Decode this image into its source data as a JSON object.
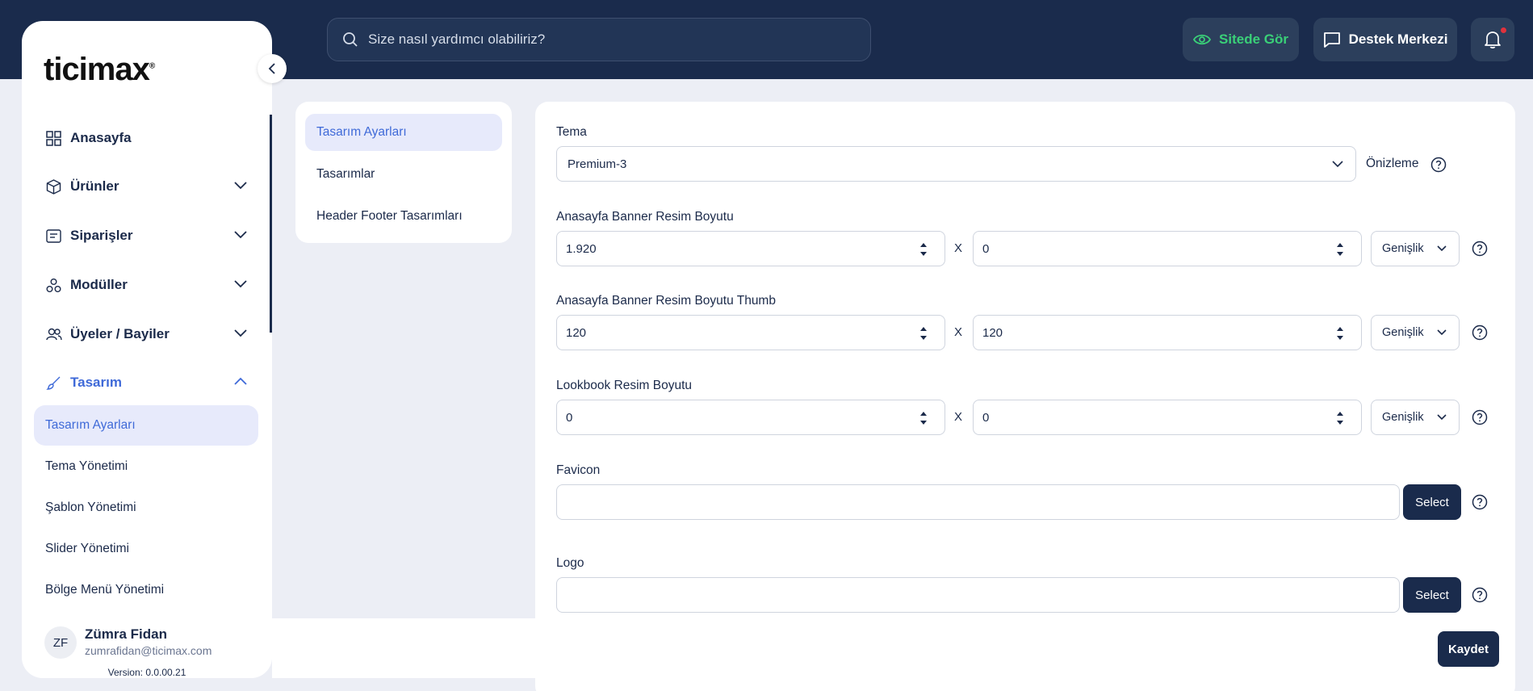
{
  "header": {
    "search_placeholder": "Size nasıl yardımcı olabiliriz?",
    "site_button": "Sitede Gör",
    "support_button": "Destek Merkezi"
  },
  "sidebar": {
    "logo": "ticimax",
    "items": [
      {
        "label": "Anasayfa",
        "icon": "grid-icon"
      },
      {
        "label": "Ürünler",
        "icon": "box-icon"
      },
      {
        "label": "Siparişler",
        "icon": "list-icon"
      },
      {
        "label": "Modüller",
        "icon": "modules-icon"
      },
      {
        "label": "Üyeler / Bayiler",
        "icon": "users-icon"
      },
      {
        "label": "Tasarım",
        "icon": "brush-icon"
      }
    ],
    "subitems": [
      "Tasarım Ayarları",
      "Tema Yönetimi",
      "Şablon Yönetimi",
      "Slider Yönetimi",
      "Bölge Menü Yönetimi"
    ],
    "user": {
      "initials": "ZF",
      "name": "Zümra Fidan",
      "email": "zumrafidan@ticimax.com",
      "version": "Version: 0.0.00.21"
    }
  },
  "subnav": [
    "Tasarım Ayarları",
    "Tasarımlar",
    "Header Footer Tasarımları"
  ],
  "form": {
    "tema_label": "Tema",
    "tema_value": "Premium-3",
    "preview_label": "Önizleme",
    "sizes": [
      {
        "label": "Anasayfa Banner Resim Boyutu",
        "w": "1.920",
        "h": "0",
        "mode": "Genişlik"
      },
      {
        "label": "Anasayfa Banner Resim Boyutu Thumb",
        "w": "120",
        "h": "120",
        "mode": "Genişlik"
      },
      {
        "label": "Lookbook Resim Boyutu",
        "w": "0",
        "h": "0",
        "mode": "Genişlik"
      }
    ],
    "x_sep": "X",
    "favicon_label": "Favicon",
    "logo_label": "Logo",
    "select_label": "Select",
    "save_label": "Kaydet"
  },
  "colors": {
    "navy": "#1a2b4c",
    "accent": "#3f6ad8",
    "green": "#3ad078"
  }
}
